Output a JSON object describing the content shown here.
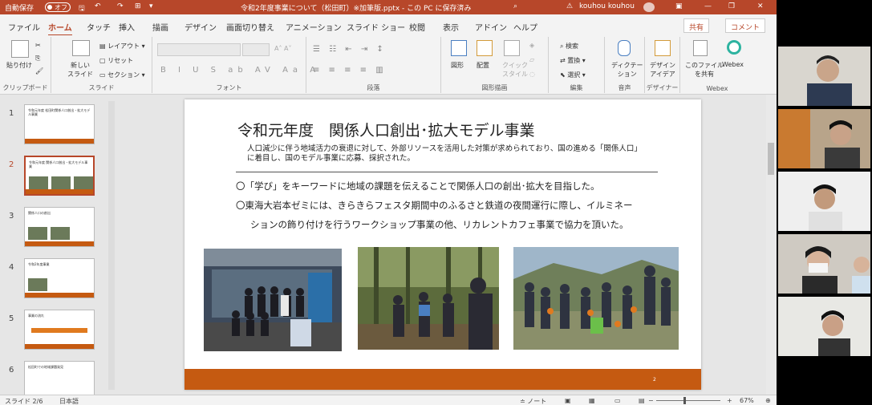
{
  "titlebar": {
    "autosave_label": "自動保存",
    "autosave_state": "オフ",
    "doc_title": "令和2年度事業について（松田町）※加筆版.pptx - この PC に保存済み",
    "user": "kouhou kouhou"
  },
  "tabs": [
    "ファイル",
    "ホーム",
    "タッチ",
    "挿入",
    "描画",
    "デザイン",
    "画面切り替え",
    "アニメーション",
    "スライド ショー",
    "校閲",
    "表示",
    "アドイン",
    "ヘルプ"
  ],
  "active_tab": "ホーム",
  "share_label": "共有",
  "comment_label": "コメント",
  "ribbon": {
    "clipboard": {
      "paste": "貼り付け",
      "label": "クリップボード"
    },
    "slides": {
      "new_slide": "新しい\nスライド",
      "layout": "レイアウト",
      "reset": "リセット",
      "section": "セクション",
      "label": "スライド"
    },
    "font": {
      "label": "フォント"
    },
    "paragraph": {
      "label": "段落"
    },
    "drawing": {
      "shape": "図形",
      "arrange": "配置",
      "quick_style": "クイック\nスタイル",
      "label": "図形描画"
    },
    "editing": {
      "find": "検索",
      "replace": "置換",
      "select": "選択",
      "label": "編集"
    },
    "voice": {
      "dictate": "ディクテー\nション",
      "label": "音声"
    },
    "designer": {
      "ideas": "デザイン\nアイデア",
      "label": "デザイナー"
    },
    "webex": {
      "share_file": "このファイル\nを共有",
      "webex": "Webex",
      "label": "Webex"
    }
  },
  "thumbnails": [
    {
      "num": "1",
      "text": "令和元年度 松田町関係人口創出・拡大モデル事業"
    },
    {
      "num": "2",
      "text": "令和元年度 関係人口創出・拡大モデル事業"
    },
    {
      "num": "3",
      "text": "関係人口の創出"
    },
    {
      "num": "4",
      "text": "令和2年度事業"
    },
    {
      "num": "5",
      "text": "事業の流れ"
    },
    {
      "num": "6",
      "text": "松田町での地域課題発見"
    }
  ],
  "active_slide": "2",
  "slide": {
    "title": "令和元年度　関係人口創出･拡大モデル事業",
    "subtitle": "人口減少に伴う地域活力の衰退に対して、外部リソースを活用した対策が求められており、国の進める「関係人口」に着目し、国のモデル事業に応募、採択された。",
    "bullet1": "〇「学び」をキーワードに地域の課題を伝えることで関係人口の創出･拡大を目指した。",
    "bullet2": "〇東海大岩本ゼミには、きらきらフェスタ期間中のふるさと鉄道の夜間運行に際し、イルミネー",
    "bullet2_cont": "ションの飾り付けを行うワークショップ事業の他、リカレントカフェ事業で協力を頂いた。",
    "page_number": "2"
  },
  "status": {
    "slide_info": "スライド 2/6",
    "language": "日本語",
    "notes": "ノート",
    "zoom": "67%"
  }
}
